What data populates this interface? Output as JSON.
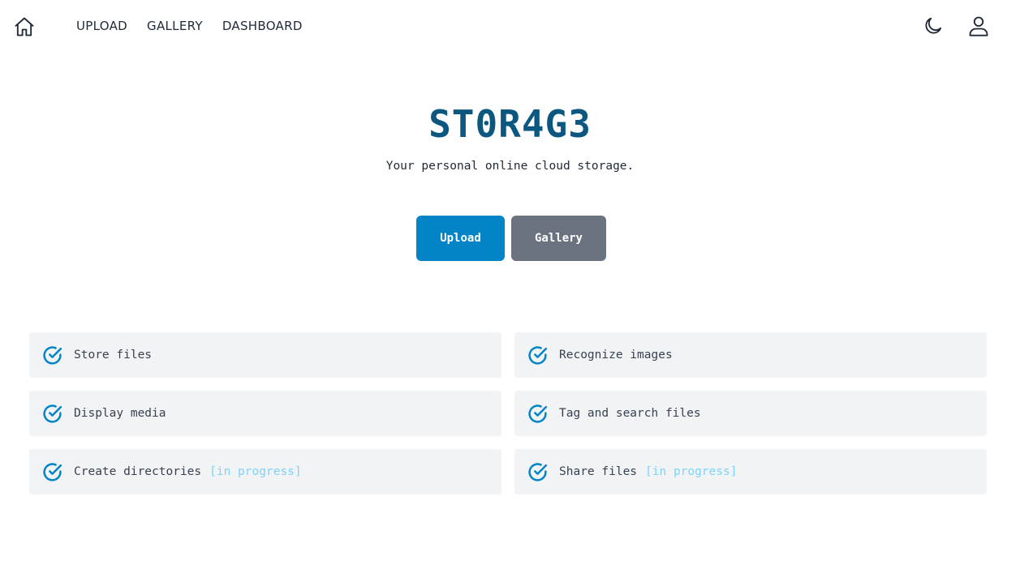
{
  "nav": {
    "home_icon": "home-icon",
    "links": [
      "UPLOAD",
      "GALLERY",
      "DASHBOARD"
    ],
    "theme_icon": "moon-icon",
    "user_icon": "user-icon"
  },
  "hero": {
    "title": "ST0R4G3",
    "subtitle": "Your personal online cloud storage.",
    "upload_label": "Upload",
    "gallery_label": "Gallery"
  },
  "features": [
    {
      "label": "Store files",
      "note": ""
    },
    {
      "label": "Recognize images",
      "note": ""
    },
    {
      "label": "Display media",
      "note": ""
    },
    {
      "label": "Tag and search files",
      "note": ""
    },
    {
      "label": "Create directories",
      "note": "[in progress]"
    },
    {
      "label": "Share files",
      "note": "[in progress]"
    }
  ],
  "colors": {
    "accent": "#0284c7",
    "title": "#0b5780",
    "secondary_button": "#6b7280",
    "feature_bg": "#f2f3f5",
    "note": "#7dd3fc"
  }
}
